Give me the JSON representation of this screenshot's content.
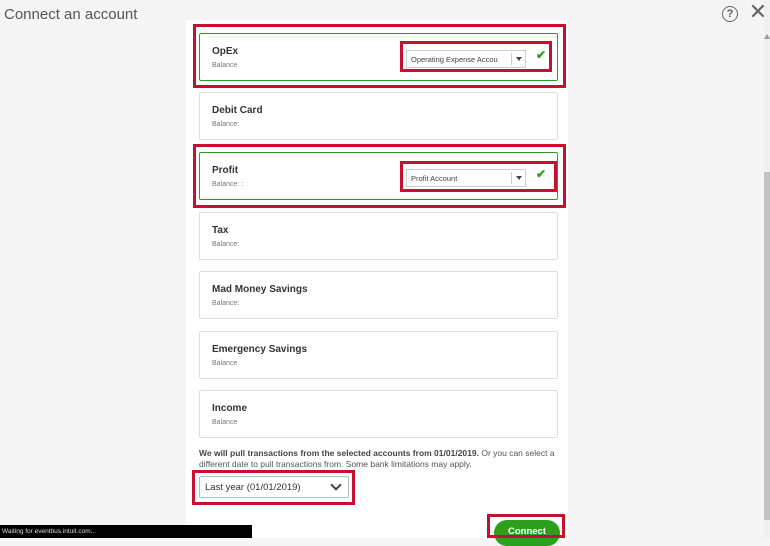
{
  "header": {
    "title": "Connect an account",
    "help_icon": "question-circle-icon",
    "help_glyph": "?",
    "close_icon": "close-icon",
    "close_glyph": "✕"
  },
  "accounts": [
    {
      "name": "OpEx",
      "balance": "Balance",
      "selected": true,
      "mapped_to": "Operating Expense Accou"
    },
    {
      "name": "Debit Card",
      "balance": "Balance:",
      "selected": false
    },
    {
      "name": "Profit",
      "balance": "Balance: :",
      "selected": true,
      "mapped_to": "Profit Account"
    },
    {
      "name": "Tax",
      "balance": "Balance:",
      "selected": false
    },
    {
      "name": "Mad Money Savings",
      "balance": "Balance:",
      "selected": false
    },
    {
      "name": "Emergency Savings",
      "balance": "Balance",
      "selected": false
    },
    {
      "name": "Income",
      "balance": "Balance",
      "selected": false
    }
  ],
  "date_note": {
    "bold": "We will pull transactions from the selected accounts from 01/01/2019.",
    "rest": " Or you can select a different date to pull transactions from. Some bank limitations may apply."
  },
  "date_range": {
    "selected": "Last year (01/01/2019)"
  },
  "connect_label": "Connect",
  "status_bar": "Waiting for eventbus.intuit.com...",
  "colors": {
    "accent": "#2ca01c",
    "highlight": "#c8102e"
  }
}
